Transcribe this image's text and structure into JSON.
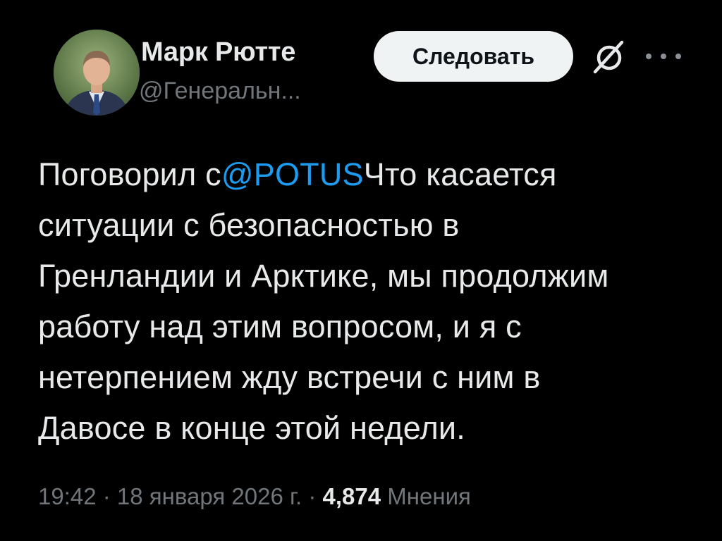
{
  "author": {
    "name": "Марк Рютте",
    "handle": "@Генеральн..."
  },
  "follow_button": {
    "label": "Следовать"
  },
  "icons": {
    "avatar": "profile-photo",
    "grok": "grok-slash-icon",
    "more": "more-horizontal-icon"
  },
  "tweet": {
    "line1_before": "Поговорил с",
    "mention": "@POTUS",
    "line1_after": "Что касается",
    "line2": "ситуации с безопасностью в",
    "line3": "Гренландии и Арктике, мы продолжим",
    "line4": "работу над этим вопросом, и я с",
    "line5": "нетерпением жду встречи с ним в",
    "line6": "Давосе в конце этой недели."
  },
  "meta": {
    "time": "19:42",
    "separator": " · ",
    "date": "18 января 2026 г.",
    "views_count": "4,874",
    "views_label": "Мнения"
  },
  "colors": {
    "background": "#000000",
    "text": "#e7e9ea",
    "secondary": "#71767b",
    "link": "#1d9bf0",
    "button_bg": "#eff3f4"
  }
}
